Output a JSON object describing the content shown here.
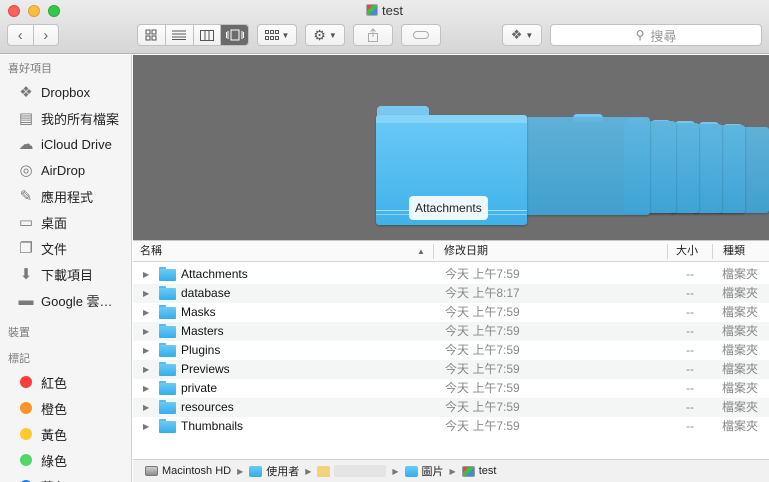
{
  "window": {
    "title": "test",
    "title_icon": "photo-library-icon"
  },
  "toolbar": {
    "back_icon": "chevron-left-icon",
    "forward_icon": "chevron-right-icon",
    "view_modes": [
      "icon-view",
      "list-view",
      "column-view",
      "cover-flow-view"
    ],
    "active_view": "cover-flow-view",
    "search_placeholder": "搜尋"
  },
  "sidebar": {
    "favorites_header": "喜好項目",
    "favorites": [
      {
        "label": "Dropbox",
        "icon": "dropbox-icon"
      },
      {
        "label": "我的所有檔案",
        "icon": "all-files-icon"
      },
      {
        "label": "iCloud Drive",
        "icon": "cloud-icon"
      },
      {
        "label": "AirDrop",
        "icon": "airdrop-icon"
      },
      {
        "label": "應用程式",
        "icon": "applications-icon"
      },
      {
        "label": "桌面",
        "icon": "desktop-icon"
      },
      {
        "label": "文件",
        "icon": "document-icon"
      },
      {
        "label": "下載項目",
        "icon": "download-icon"
      },
      {
        "label": "Google 雲…",
        "icon": "folder-icon"
      }
    ],
    "devices_header": "裝置",
    "tags_header": "標記",
    "tags": [
      {
        "label": "紅色",
        "color": "#fc3d39"
      },
      {
        "label": "橙色",
        "color": "#fd9426"
      },
      {
        "label": "黃色",
        "color": "#fecb2e"
      },
      {
        "label": "綠色",
        "color": "#53d769"
      },
      {
        "label": "藍色",
        "color": "#147efb"
      }
    ]
  },
  "coverflow": {
    "selected_caption": "Attachments"
  },
  "columns": {
    "name": "名稱",
    "date": "修改日期",
    "size": "大小",
    "kind": "種類"
  },
  "files": [
    {
      "name": "Attachments",
      "date": "今天 上午7:59",
      "size": "--",
      "kind": "檔案夾"
    },
    {
      "name": "database",
      "date": "今天 上午8:17",
      "size": "--",
      "kind": "檔案夾"
    },
    {
      "name": "Masks",
      "date": "今天 上午7:59",
      "size": "--",
      "kind": "檔案夾"
    },
    {
      "name": "Masters",
      "date": "今天 上午7:59",
      "size": "--",
      "kind": "檔案夾"
    },
    {
      "name": "Plugins",
      "date": "今天 上午7:59",
      "size": "--",
      "kind": "檔案夾"
    },
    {
      "name": "Previews",
      "date": "今天 上午7:59",
      "size": "--",
      "kind": "檔案夾"
    },
    {
      "name": "private",
      "date": "今天 上午7:59",
      "size": "--",
      "kind": "檔案夾"
    },
    {
      "name": "resources",
      "date": "今天 上午7:59",
      "size": "--",
      "kind": "檔案夾"
    },
    {
      "name": "Thumbnails",
      "date": "今天 上午7:59",
      "size": "--",
      "kind": "檔案夾"
    }
  ],
  "path_bar": {
    "volume": "Macintosh HD",
    "users": "使用者",
    "pictures": "圖片",
    "current": "test"
  }
}
